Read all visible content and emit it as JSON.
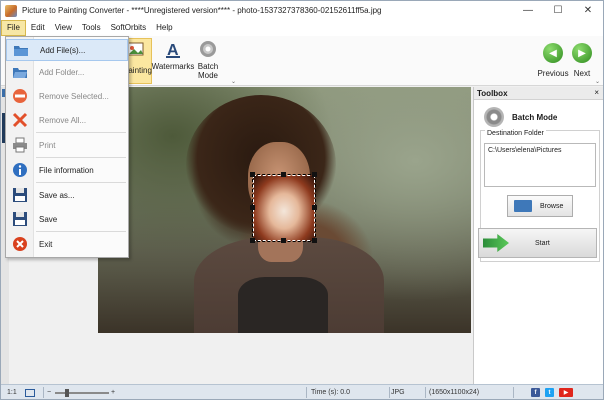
{
  "window": {
    "title": "Picture to Painting Converter - ****Unregistered version**** - photo-1537327378360-02152611ff5a.jpg",
    "minimize": "—",
    "maximize": "☐",
    "close": "✕"
  },
  "menu": {
    "items": [
      "File",
      "Edit",
      "View",
      "Tools",
      "SoftOrbits",
      "Help"
    ]
  },
  "ribbon": {
    "painting_label": "Painting",
    "watermarks_label": "Watermarks",
    "batch_label_1": "Batch",
    "batch_label_2": "Mode",
    "previous_label": "Previous",
    "next_label": "Next",
    "collapse_glyph": "⌄"
  },
  "file_menu": {
    "items": [
      {
        "label": "Add File(s)...",
        "icon": "add-file-icon",
        "disabled": false,
        "hover": true
      },
      {
        "label": "Add Folder...",
        "icon": "add-folder-icon",
        "disabled": true
      },
      {
        "label": "Remove Selected...",
        "icon": "remove-selected-icon",
        "disabled": true
      },
      {
        "label": "Remove All...",
        "icon": "remove-all-icon",
        "disabled": true
      },
      {
        "label": "Print",
        "icon": "print-icon",
        "disabled": true
      },
      {
        "label": "File information",
        "icon": "info-icon",
        "disabled": false
      },
      {
        "label": "Save as...",
        "icon": "save-as-icon",
        "disabled": false
      },
      {
        "label": "Save",
        "icon": "save-icon",
        "disabled": false
      },
      {
        "label": "Exit",
        "icon": "exit-icon",
        "disabled": false
      }
    ]
  },
  "toolbox": {
    "header": "Toolbox",
    "close_glyph": "×",
    "title": "Batch Mode",
    "group_label": "Destination Folder",
    "folder_path": "C:\\Users\\elena\\Pictures",
    "browse_label": "Browse",
    "start_label": "Start"
  },
  "status": {
    "zoom_ratio": "1:1",
    "time": "Time (s): 0.0",
    "format": "JPG",
    "dimensions": "(1650x1100x24)",
    "minus": "−",
    "plus": "+"
  },
  "colors": {
    "accent_green": "#2e8b1e",
    "menu_active": "#f7e7a6",
    "statusbar": "#dfe6ee"
  }
}
